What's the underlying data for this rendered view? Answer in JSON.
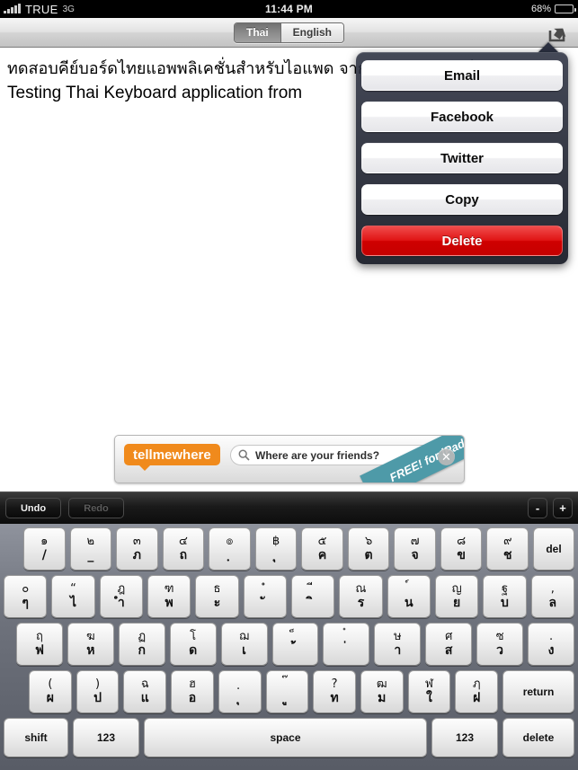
{
  "status_bar": {
    "carrier": "TRUE",
    "network": "3G",
    "time": "11:44 PM",
    "battery_percent": "68%"
  },
  "nav_bar": {
    "segments": [
      {
        "label": "Thai",
        "selected": true
      },
      {
        "label": "English",
        "selected": false
      }
    ],
    "share_icon": "share-icon"
  },
  "document": {
    "thai_line": "ทดสอบคีย์บอร์ดไทยแอพพลิเคชั่นสำหรับไอแพด จาก มาชากะซอฟต์ดอทคอม",
    "english_line": "Testing Thai Keyboard application  from"
  },
  "action_sheet": {
    "items": [
      {
        "label": "Email",
        "style": "default"
      },
      {
        "label": "Facebook",
        "style": "default"
      },
      {
        "label": "Twitter",
        "style": "default"
      },
      {
        "label": "Copy",
        "style": "default"
      },
      {
        "label": "Delete",
        "style": "destructive"
      }
    ],
    "destructive_color": "#cf0000"
  },
  "ad": {
    "brand_part1": "tell",
    "brand_part2": "me",
    "brand_part3": "where",
    "brand_color": "#f08a1c",
    "search_placeholder": "Where are your friends?",
    "ribbon_text": "FREE! for iPad",
    "ribbon_color": "#4e9aa8",
    "close_label": "✕"
  },
  "keyboard_toolbar": {
    "undo_label": "Undo",
    "redo_label": "Redo",
    "redo_disabled": true,
    "minus_label": "-",
    "plus_label": "+"
  },
  "keyboard": {
    "row1": [
      {
        "top": "๑",
        "bot": "/"
      },
      {
        "top": "๒",
        "bot": "_"
      },
      {
        "top": "๓",
        "bot": "ภ"
      },
      {
        "top": "๔",
        "bot": "ถ"
      },
      {
        "top": "๏",
        "bot": "ฺ"
      },
      {
        "top": "฿",
        "bot": "ุ"
      },
      {
        "top": "๕",
        "bot": "ค"
      },
      {
        "top": "๖",
        "bot": "ต"
      },
      {
        "top": "๗",
        "bot": "จ"
      },
      {
        "top": "๘",
        "bot": "ข"
      },
      {
        "top": "๙",
        "bot": "ช"
      }
    ],
    "row1_del": "del",
    "row2": [
      {
        "top": "๐",
        "bot": "ๆ"
      },
      {
        "top": "“",
        "bot": "ไ"
      },
      {
        "top": "ฎ",
        "bot": "ำ"
      },
      {
        "top": "ฑ",
        "bot": "พ"
      },
      {
        "top": "ธ",
        "bot": "ะ"
      },
      {
        "top": "ํ",
        "bot": "ั"
      },
      {
        "top": "ี",
        "bot": "ิ"
      },
      {
        "top": "ณ",
        "bot": "ร"
      },
      {
        "top": "์",
        "bot": "น"
      },
      {
        "top": "ญ",
        "bot": "ย"
      },
      {
        "top": "ฐ",
        "bot": "บ"
      },
      {
        "top": ",",
        "bot": "ล"
      }
    ],
    "row3": [
      {
        "top": "ฤ",
        "bot": "ฟ"
      },
      {
        "top": "ฆ",
        "bot": "ห"
      },
      {
        "top": "ฏ",
        "bot": "ก"
      },
      {
        "top": "โ",
        "bot": "ด"
      },
      {
        "top": "ฌ",
        "bot": "เ"
      },
      {
        "top": "็",
        "bot": "้"
      },
      {
        "top": "๋",
        "bot": "่"
      },
      {
        "top": "ษ",
        "bot": "า"
      },
      {
        "top": "ศ",
        "bot": "ส"
      },
      {
        "top": "ซ",
        "bot": "ว"
      },
      {
        "top": ".",
        "bot": "ง"
      }
    ],
    "row4": [
      {
        "top": "(",
        "bot": "ผ"
      },
      {
        "top": ")",
        "bot": "ป"
      },
      {
        "top": "ฉ",
        "bot": "แ"
      },
      {
        "top": "ฮ",
        "bot": "อ"
      },
      {
        "top": "ฺ",
        "bot": "ุ"
      },
      {
        "top": "๊",
        "bot": "ู"
      },
      {
        "top": "?",
        "bot": "ท"
      },
      {
        "top": "ฒ",
        "bot": "ม"
      },
      {
        "top": "ฬ",
        "bot": "ใ"
      },
      {
        "top": "ฦ",
        "bot": "ฝ"
      }
    ],
    "row4_return": "return",
    "row5": {
      "shift": "shift",
      "num_left": "123",
      "space": "space",
      "num_right": "123",
      "delete": "delete"
    }
  }
}
